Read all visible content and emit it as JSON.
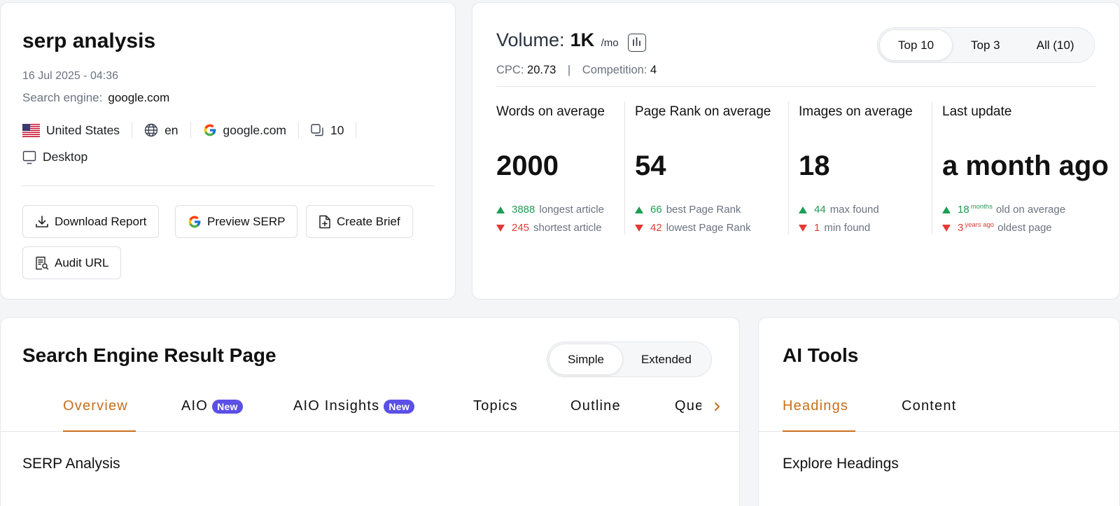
{
  "query": {
    "title": "serp analysis",
    "date": "16 Jul 2025 - 04:36",
    "search_engine_label": "Search engine:",
    "search_engine_value": "google.com",
    "country": "United States",
    "language": "en",
    "engine": "google.com",
    "results_count": "10",
    "device": "Desktop",
    "buttons": {
      "download": "Download Report",
      "preview": "Preview SERP",
      "brief": "Create Brief",
      "audit": "Audit URL"
    }
  },
  "volume": {
    "label": "Volume:",
    "value": "1K",
    "unit": "/mo",
    "cpc_label": "CPC:",
    "cpc_value": "20.73",
    "separator": "|",
    "competition_label": "Competition:",
    "competition_value": "4",
    "segments": [
      "Top 10",
      "Top 3",
      "All (10)"
    ],
    "active_segment": "Top 10"
  },
  "stats": [
    {
      "title": "Words on average",
      "value": "2000",
      "up_num": "3888",
      "up_text": "longest article",
      "down_num": "245",
      "down_text": "shortest article"
    },
    {
      "title": "Page Rank on average",
      "value": "54",
      "up_num": "66",
      "up_text": "best Page Rank",
      "down_num": "42",
      "down_text": "lowest Page Rank"
    },
    {
      "title": "Images on average",
      "value": "18",
      "up_num": "44",
      "up_text": "max found",
      "down_num": "1",
      "down_text": "min found"
    },
    {
      "title": "Last update",
      "value": "a month ago",
      "up_num": "18",
      "up_sup": "months",
      "up_text": "old on average",
      "down_num": "3",
      "down_sup": "years ago",
      "down_text": "oldest page"
    }
  ],
  "serp": {
    "title": "Search Engine Result Page",
    "view_toggle": [
      "Simple",
      "Extended"
    ],
    "active_view": "Simple",
    "tabs": [
      {
        "label": "Overview"
      },
      {
        "label": "AIO",
        "badge": "New"
      },
      {
        "label": "AIO Insights",
        "badge": "New"
      },
      {
        "label": "Topics"
      },
      {
        "label": "Outline"
      },
      {
        "label": "Que"
      }
    ],
    "active_tab": "Overview",
    "section": "SERP Analysis"
  },
  "ai_tools": {
    "title": "AI Tools",
    "tabs": [
      "Headings",
      "Content"
    ],
    "active_tab": "Headings",
    "section": "Explore Headings"
  },
  "colors": {
    "accent": "#c96f1b",
    "badge": "#5a4fe6",
    "up": "#1f9d55",
    "down": "#e53935"
  }
}
